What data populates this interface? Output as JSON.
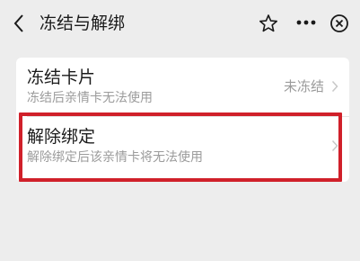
{
  "header": {
    "title": "冻结与解绑",
    "back_icon": "chevron-left-icon",
    "favorite_icon": "star-outline-icon",
    "more_icon": "more-dots-icon",
    "close_icon": "close-circle-icon"
  },
  "menu": {
    "items": [
      {
        "title": "冻结卡片",
        "subtitle": "冻结后亲情卡无法使用",
        "status": "未冻结",
        "icon": "chevron-right-icon"
      },
      {
        "title": "解除绑定",
        "subtitle": "解除绑定后该亲情卡将无法使用",
        "status": "",
        "icon": "chevron-right-icon"
      }
    ]
  },
  "colors": {
    "background": "#ededed",
    "card": "#ffffff",
    "primary_text": "#1a1a1a",
    "secondary_text": "#9b9b9b",
    "highlight": "#d0202a"
  }
}
